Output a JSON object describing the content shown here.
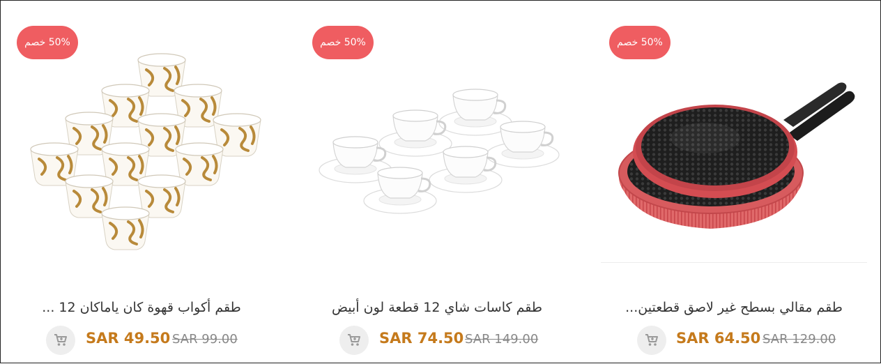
{
  "products": [
    {
      "badge": "50% خصم",
      "title": "طقم أكواب قهوة كان ياماكان 12 ...",
      "price": "SAR 49.50",
      "old_price": "SAR 99.00",
      "image": "coffee-cups-set"
    },
    {
      "badge": "50% خصم",
      "title": "طقم كاسات شاي 12 قطعة لون أبيض",
      "price": "SAR 74.50",
      "old_price": "SAR 149.00",
      "image": "white-tea-cups-set"
    },
    {
      "badge": "50% خصم",
      "title": "طقم مقالي بسطح غير لاصق قطعتين...",
      "price": "SAR 64.50",
      "old_price": "SAR 129.00",
      "image": "frying-pans-set"
    }
  ],
  "colors": {
    "badge": "#ef5d61",
    "price": "#c57a1c",
    "old_price": "#888888",
    "cart_bg": "#eeeeee"
  },
  "icons": {
    "cart": "shopping-cart-icon"
  }
}
